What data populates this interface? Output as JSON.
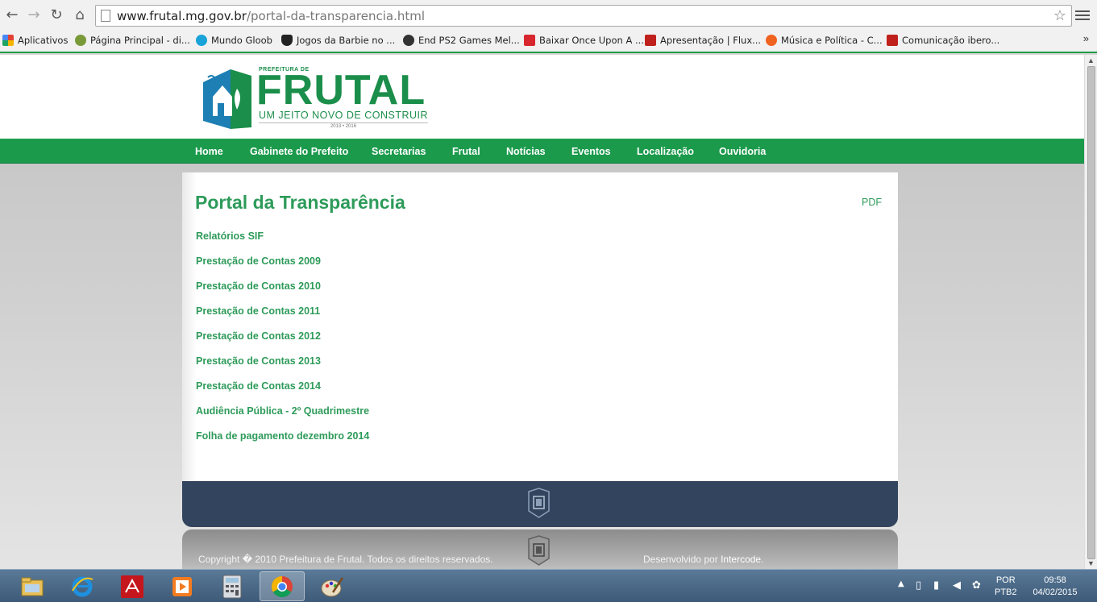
{
  "browser": {
    "url_host": "www.frutal.mg.gov.br",
    "url_path": "/portal-da-transparencia.html",
    "bookmarks": [
      {
        "label": "Aplicativos",
        "color": "#e34133"
      },
      {
        "label": "Página Principal - di...",
        "color": "#7a9a3a"
      },
      {
        "label": "Mundo Gloob",
        "color": "#1aa3d9"
      },
      {
        "label": "Jogos da Barbie no ...",
        "color": "#222222"
      },
      {
        "label": "End PS2 Games Mel...",
        "color": "#333333"
      },
      {
        "label": "Baixar Once Upon A ...",
        "color": "#d8262e"
      },
      {
        "label": "Apresentação | Flux...",
        "color": "#c0201c"
      },
      {
        "label": "Música e Política - C...",
        "color": "#f0621f"
      },
      {
        "label": "Comunicação ibero...",
        "color": "#c0201c"
      }
    ],
    "more_bookmarks": "»"
  },
  "site": {
    "logo": {
      "prefix": "PREFEITURA DE",
      "name": "FRUTAL",
      "tagline": "UM JEITO NOVO DE CONSTRUIR",
      "years": "2013 • 2016"
    },
    "nav": [
      "Home",
      "Gabinete do Prefeito",
      "Secretarias",
      "Frutal",
      "Notícias",
      "Eventos",
      "Localização",
      "Ouvidoria"
    ],
    "accent_color": "#1b9a4c",
    "link_color": "#2e9b5a"
  },
  "main": {
    "title": "Portal da Transparência",
    "pdf_label": "PDF",
    "links": [
      "Relatórios SIF",
      "Prestação de Contas 2009",
      "Prestação de Contas 2010",
      "Prestação de Contas 2011",
      "Prestação de Contas 2012",
      "Prestação de Contas 2013",
      "Prestação de Contas 2014",
      "Audiência Pública - 2º Quadrimestre",
      "Folha de pagamento dezembro 2014"
    ]
  },
  "footer": {
    "copyright": "Copyright � 2010 Prefeitura de Frutal. Todos os direitos reservados.",
    "dev_prefix": "Desenvolvido por ",
    "dev_name": "Intercode",
    "dev_suffix": "."
  },
  "taskbar": {
    "apps": [
      "file-explorer",
      "internet-explorer",
      "adobe-reader",
      "media-player",
      "calculator",
      "chrome",
      "paint"
    ],
    "active_app": "chrome",
    "language": "POR",
    "keyboard": "PTB2",
    "time": "09:58",
    "date": "04/02/2015"
  }
}
